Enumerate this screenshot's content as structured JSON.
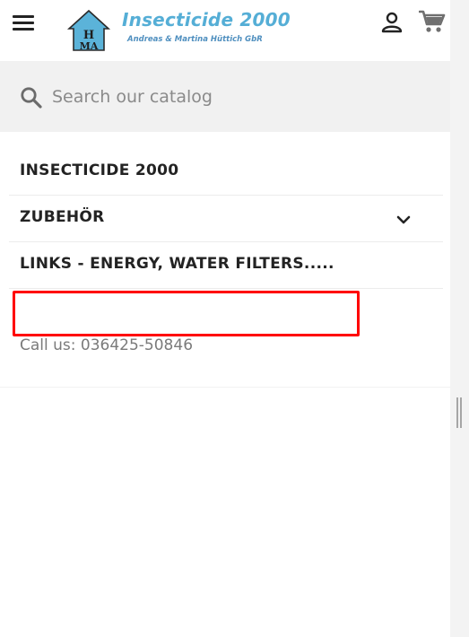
{
  "header": {
    "brand_title": "Insecticide 2000",
    "brand_subtitle": "Andreas & Martina Hüttich GbR",
    "logo_letters": "HMA",
    "menu_icon": "hamburger-menu-icon",
    "account_icon": "user-account-icon",
    "cart_icon": "shopping-cart-icon"
  },
  "search": {
    "placeholder": "Search our catalog",
    "value": "",
    "icon": "search-icon"
  },
  "menu": {
    "items": [
      {
        "label": "INSECTICIDE 2000",
        "has_submenu": false
      },
      {
        "label": "ZUBEHÖR",
        "has_submenu": true
      },
      {
        "label": "LINKS - ENERGY, WATER FILTERS.....",
        "has_submenu": false
      }
    ]
  },
  "contact": {
    "call_us": "Call us: 036425-50846"
  },
  "colors": {
    "brand_blue": "#55aed6",
    "highlight": "#ff0000",
    "search_bg": "#f1f1f1"
  }
}
